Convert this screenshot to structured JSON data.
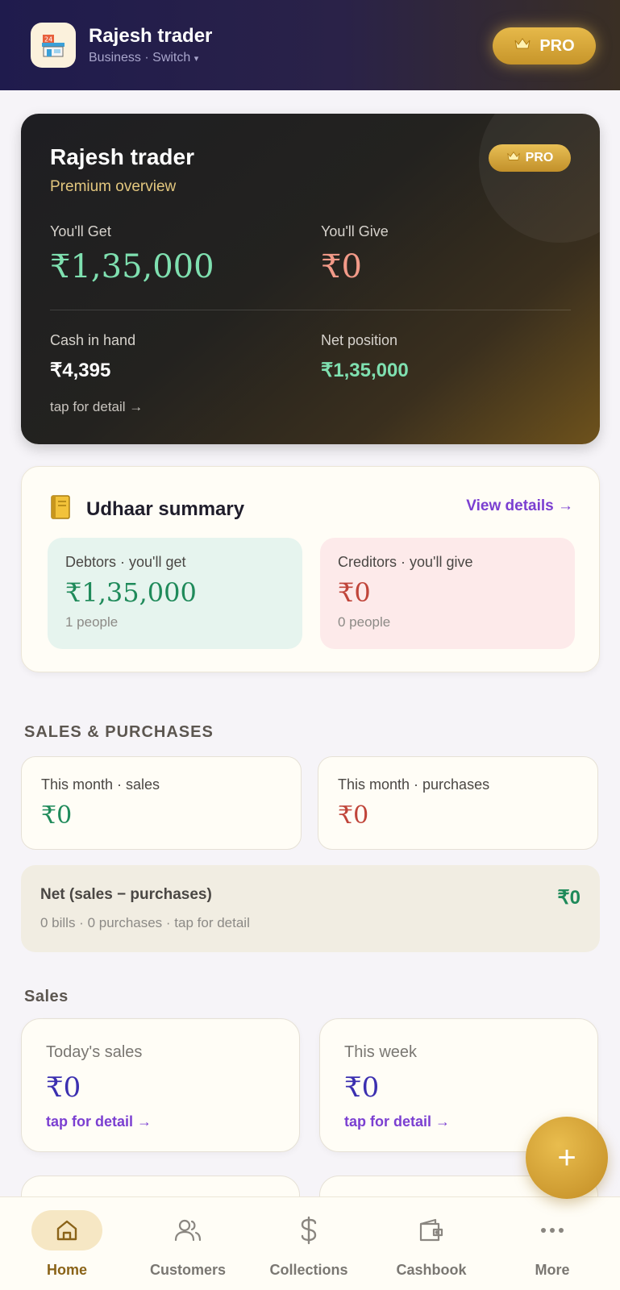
{
  "header": {
    "business_name": "Rajesh trader",
    "business_sub": "Business · Switch",
    "switch_arrow": "▾",
    "pro_label": "PRO",
    "logo_icon": "store-icon"
  },
  "hero": {
    "title": "Rajesh trader",
    "subtitle": "Premium overview",
    "pro_label": "PRO",
    "get_label": "You'll Get",
    "get_value": "₹1,35,000",
    "give_label": "You'll Give",
    "give_value": "₹0",
    "cash_label": "Cash in hand",
    "cash_value": "₹4,395",
    "net_label": "Net position",
    "net_value": "₹1,35,000",
    "tap_label": "tap for detail →"
  },
  "udhaar": {
    "icon": "ledger-icon",
    "title": "Udhaar summary",
    "view_details": "View details →",
    "debtors_label": "Debtors · you'll get",
    "debtors_value": "₹1,35,000",
    "debtors_people": "1 people",
    "creditors_label": "Creditors · you'll give",
    "creditors_value": "₹0",
    "creditors_people": "0 people"
  },
  "sales_purchases": {
    "section_title": "SALES & PURCHASES",
    "month_sales_label": "This month · sales",
    "month_sales_value": "₹0",
    "month_purchases_label": "This month · purchases",
    "month_purchases_value": "₹0",
    "net_label": "Net (sales − purchases)",
    "net_value": "₹0",
    "net_sub": "0 bills · 0 purchases · tap for detail"
  },
  "sales": {
    "section_title": "Sales",
    "today_label": "Today's sales",
    "today_value": "₹0",
    "today_tap": "tap for detail →",
    "week_label": "This week",
    "week_value": "₹0",
    "week_tap": "tap for detail →"
  },
  "fab": {
    "label": "+"
  },
  "nav": {
    "items": [
      {
        "label": "Home",
        "icon": "home-icon"
      },
      {
        "label": "Customers",
        "icon": "users-icon"
      },
      {
        "label": "Collections",
        "icon": "dollar-icon"
      },
      {
        "label": "Cashbook",
        "icon": "wallet-icon"
      },
      {
        "label": "More",
        "icon": "more-icon"
      }
    ]
  },
  "colors": {
    "accent_gold": "#d9a93a",
    "positive_green": "#1f8a5a",
    "negative_red": "#c0453a",
    "link_purple": "#7b3fd1",
    "amount_indigo": "#3b2fb0"
  }
}
